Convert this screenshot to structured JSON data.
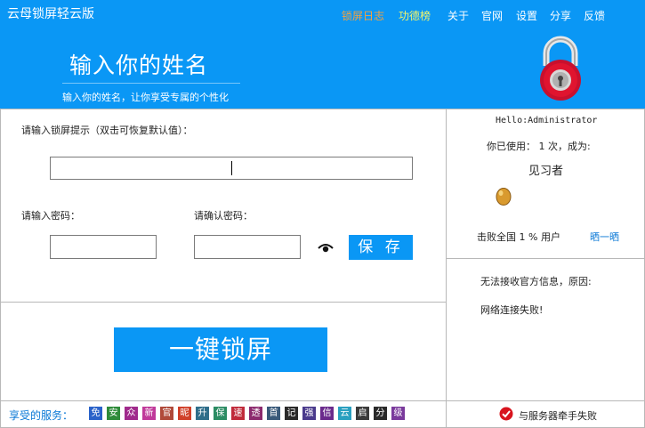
{
  "app": {
    "title": "云母锁屏轻云版"
  },
  "menu": [
    {
      "key": "log",
      "label": "锁屏日志",
      "color": "#f7a23e"
    },
    {
      "key": "merit",
      "label": "功德榜",
      "color": "#f3f56a"
    },
    {
      "key": "about",
      "label": "关于",
      "color": "#ffffff"
    },
    {
      "key": "site",
      "label": "官网",
      "color": "#ffffff"
    },
    {
      "key": "settings",
      "label": "设置",
      "color": "#ffffff"
    },
    {
      "key": "share",
      "label": "分享",
      "color": "#ffffff"
    },
    {
      "key": "feedback",
      "label": "反馈",
      "color": "#ffffff"
    }
  ],
  "header": {
    "title": "输入你的姓名",
    "subtitle": "输入你的姓名，让你享受专属的个性化"
  },
  "form": {
    "hint_label": "请输入锁屏提示（双击可恢复默认值）：",
    "hint_value": "",
    "password_label": "请输入密码：",
    "password_value": "",
    "confirm_label": "请确认密码：",
    "confirm_value": "",
    "save_label": "保 存",
    "lock_label": "一键锁屏"
  },
  "user": {
    "greeting": "Hello:Administrator",
    "usage": "你已使用： 1 次，成为:",
    "rank": "见习者",
    "beat": "击败全国 1 % 用户",
    "share_link": "晒一晒"
  },
  "notice": {
    "line1": "无法接收官方信息，原因:",
    "line2": "网络连接失败!"
  },
  "services": {
    "label": "享受的服务：",
    "items": [
      {
        "t": "免",
        "c": "#2a62c9"
      },
      {
        "t": "安",
        "c": "#2e8b3a"
      },
      {
        "t": "众",
        "c": "#a02a8c"
      },
      {
        "t": "新",
        "c": "#c0399a"
      },
      {
        "t": "官",
        "c": "#b04a3a"
      },
      {
        "t": "昵",
        "c": "#d0402a"
      },
      {
        "t": "升",
        "c": "#2f6e8a"
      },
      {
        "t": "保",
        "c": "#2c8c63"
      },
      {
        "t": "速",
        "c": "#c02a3a"
      },
      {
        "t": "透",
        "c": "#8c2a6e"
      },
      {
        "t": "首",
        "c": "#3a5a7a"
      },
      {
        "t": "记",
        "c": "#2a2a2a"
      },
      {
        "t": "强",
        "c": "#4a3a8c"
      },
      {
        "t": "信",
        "c": "#6a2a8c"
      },
      {
        "t": "云",
        "c": "#2aa0c0"
      },
      {
        "t": "启",
        "c": "#3a3a3a"
      },
      {
        "t": "分",
        "c": "#2a2a2a"
      },
      {
        "t": "级",
        "c": "#7a3a9c"
      }
    ]
  },
  "status": {
    "text": "与服务器牵手失败"
  }
}
